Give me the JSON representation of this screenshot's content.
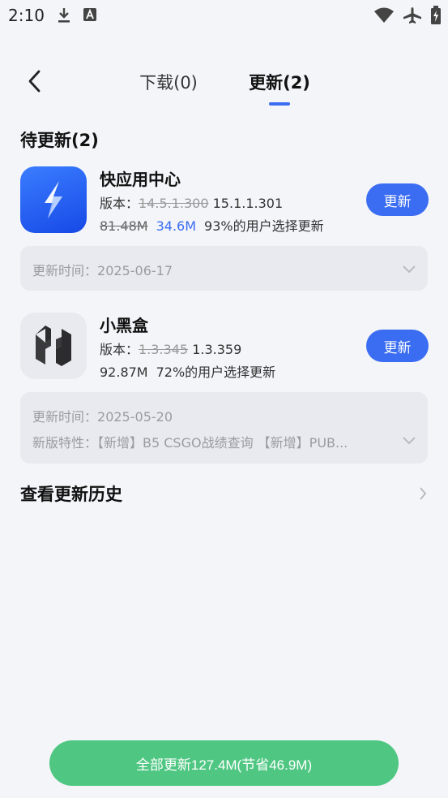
{
  "status_bar": {
    "time": "2:10",
    "left_icons": [
      "download-icon",
      "font-app-icon"
    ],
    "right_icons": [
      "wifi-icon",
      "airplane-icon",
      "battery-charging-icon"
    ]
  },
  "nav": {
    "back_icon": "back-arrow-icon",
    "tabs": [
      {
        "label": "下载(0)",
        "active": false
      },
      {
        "label": "更新(2)",
        "active": true
      }
    ],
    "accent_color": "#3b6df2"
  },
  "pending": {
    "title": "待更新(2)",
    "apps": [
      {
        "name": "快应用中心",
        "version_prefix": "版本：",
        "old_version": "14.5.1.300",
        "new_version": "15.1.1.301",
        "old_size": "81.48M",
        "new_size": "34.6M",
        "users_note": "93%的用户选择更新",
        "button_label": "更新",
        "icon": "lightning-bolt-icon",
        "info": {
          "update_time_label": "更新时间：",
          "update_time": "2025-06-17"
        }
      },
      {
        "name": "小黑盒",
        "version_prefix": "版本：",
        "old_version": "1.3.345",
        "new_version": "1.3.359",
        "size": "92.87M",
        "users_note": "72%的用户选择更新",
        "button_label": "更新",
        "icon": "xiaoheihe-logo-icon",
        "info": {
          "update_time_label": "更新时间：",
          "update_time": "2025-05-20",
          "features_label": "新版特性：",
          "features": "【新增】B5 CSGO战绩查询 【新增】PUB..."
        }
      }
    ]
  },
  "history": {
    "label": "查看更新历史",
    "icon": "chevron-right-icon"
  },
  "update_all": {
    "label": "全部更新127.4M(节省46.9M)",
    "color": "#4fc782"
  }
}
